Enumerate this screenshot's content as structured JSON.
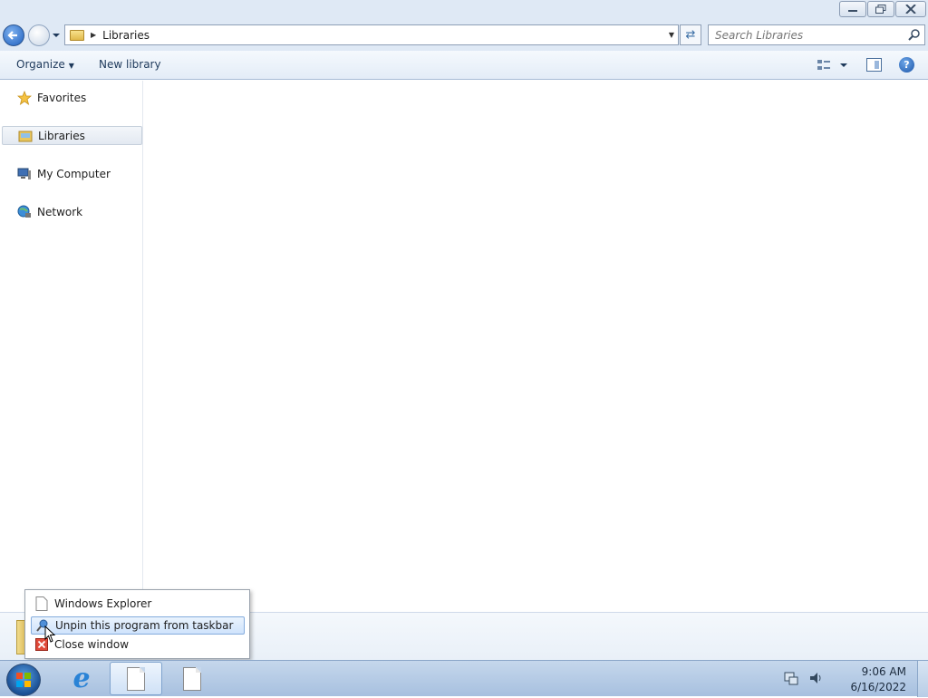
{
  "address": {
    "crumb": "Libraries"
  },
  "search": {
    "placeholder": "Search Libraries"
  },
  "toolbar": {
    "organize": "Organize",
    "new_library": "New library"
  },
  "nav": {
    "items": [
      {
        "label": "Favorites",
        "icon": "star-icon"
      },
      {
        "label": "Libraries",
        "icon": "libraries-folder-icon"
      },
      {
        "label": "My Computer",
        "icon": "computer-icon"
      },
      {
        "label": "Network",
        "icon": "network-icon"
      }
    ]
  },
  "jumplist": {
    "items": [
      {
        "label": "Windows Explorer",
        "icon": "document-icon"
      },
      {
        "label": "Unpin this program from taskbar",
        "icon": "unpin-icon"
      },
      {
        "label": "Close window",
        "icon": "close-window-icon"
      }
    ]
  },
  "clock": {
    "time": "9:06 AM",
    "date": "6/16/2022"
  },
  "colors": {
    "selection": "#cfe3fc",
    "taskbar": "#a7c0df",
    "accent": "#1d5fbf"
  }
}
